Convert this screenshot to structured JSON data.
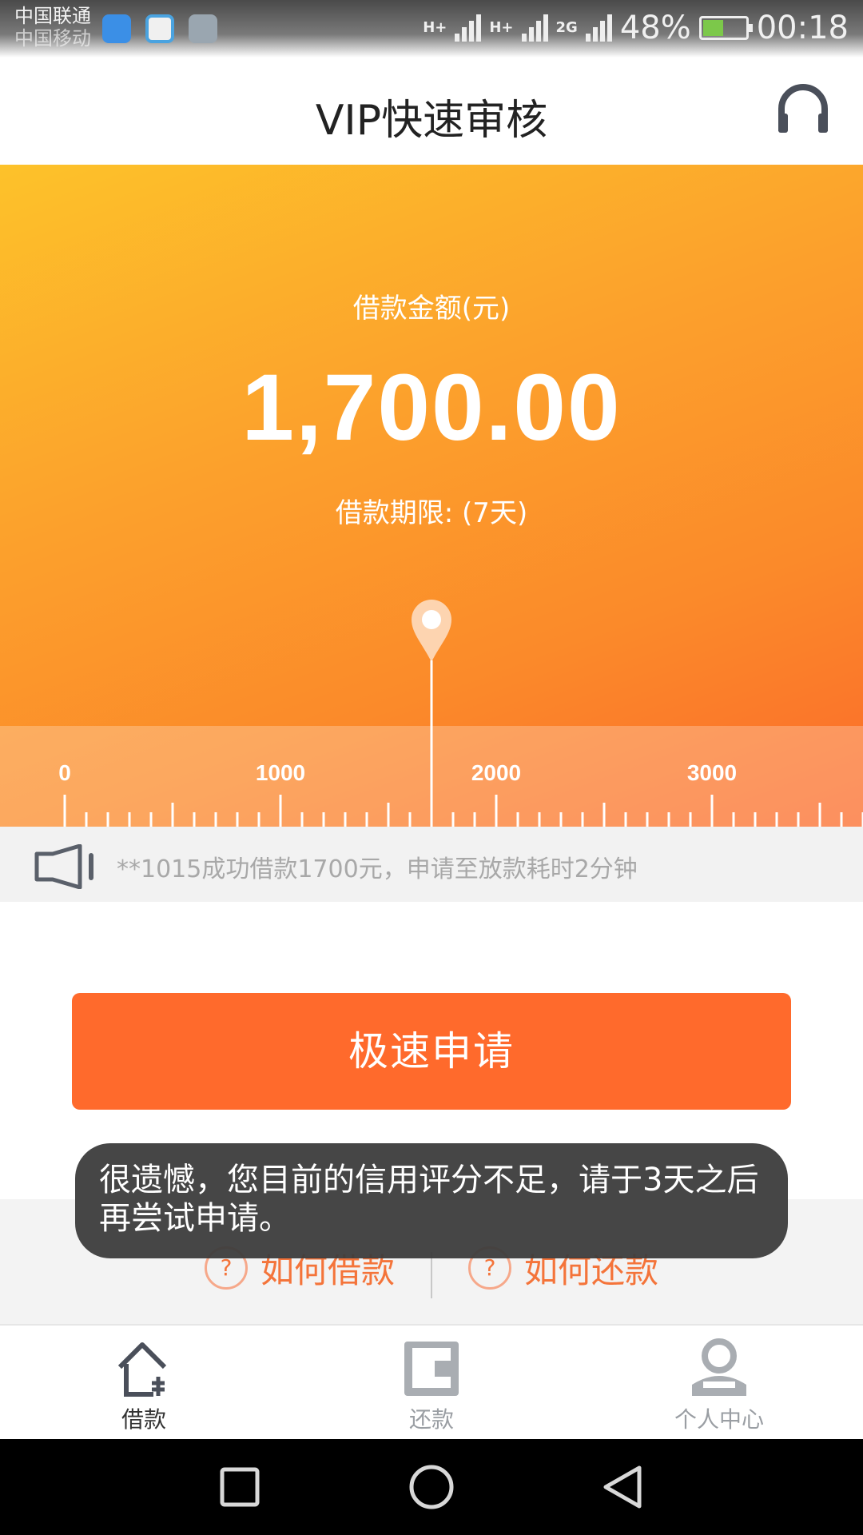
{
  "status_bar": {
    "carrier_1": "中国联通",
    "carrier_2": "中国移动",
    "net_1": "H+",
    "net_2": "H+",
    "net_3": "2G",
    "battery": "48%",
    "time": "00:18"
  },
  "header": {
    "title": "VIP快速审核",
    "support_icon": "headset-icon"
  },
  "loan": {
    "amount_label": "借款金额(元)",
    "amount": "1,700.00",
    "term": "借款期限: (7天)",
    "slider_value": 1700,
    "ruler_labels": [
      "0",
      "1000",
      "2000",
      "3000"
    ]
  },
  "ticker": {
    "icon": "speaker-icon",
    "text": "**1015成功借款1700元，申请至放款耗时2分钟"
  },
  "apply_button": "极速申请",
  "toast": "很遗憾，您目前的信用评分不足，请于3天之后再尝试申请。",
  "help": {
    "how_to_borrow": "如何借款",
    "how_to_repay": "如何还款"
  },
  "tabs": [
    {
      "label": "借款",
      "icon": "home-icon",
      "active": true
    },
    {
      "label": "还款",
      "icon": "wallet-icon",
      "active": false
    },
    {
      "label": "个人中心",
      "icon": "person-icon",
      "active": false
    }
  ],
  "colors": {
    "accent": "#ff6a2c",
    "hero_start": "#fdc22a",
    "hero_end": "#fb6a2a"
  }
}
